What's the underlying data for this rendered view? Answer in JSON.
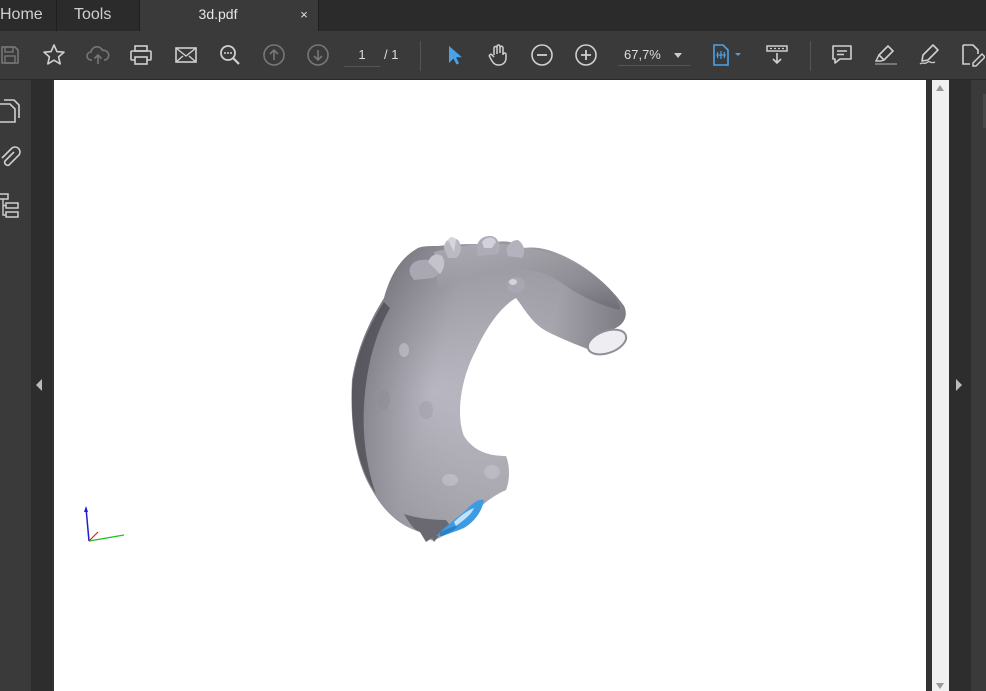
{
  "tabs": {
    "home_label": "Home",
    "tools_label": "Tools",
    "document_label": "3d.pdf",
    "close_glyph": "×"
  },
  "toolbar": {
    "icons": [
      "save-icon",
      "star-icon",
      "cloud-upload-icon",
      "print-icon",
      "email-icon",
      "search-icon",
      "page-up-icon",
      "page-down-icon",
      "select-arrow-icon",
      "hand-icon",
      "zoom-out-icon",
      "zoom-in-icon",
      "fit-page-icon",
      "scroll-mode-icon",
      "comment-icon",
      "highlight-icon",
      "sign-icon",
      "edit-pdf-icon"
    ],
    "page_current": "1",
    "page_total": "/ 1",
    "zoom_value": "67,7%"
  },
  "left_rail": {
    "icons": [
      "pages-icon",
      "attachment-icon",
      "model-tree-icon"
    ]
  },
  "viewer": {
    "content": "3d-aorta-model",
    "colors": {
      "toolbar": "#3a3a3a",
      "tabbar": "#2b2b2b",
      "accent": "#4aa3e8",
      "model_gray": "#b8b6c0",
      "model_blue": "#3f9be0"
    }
  }
}
